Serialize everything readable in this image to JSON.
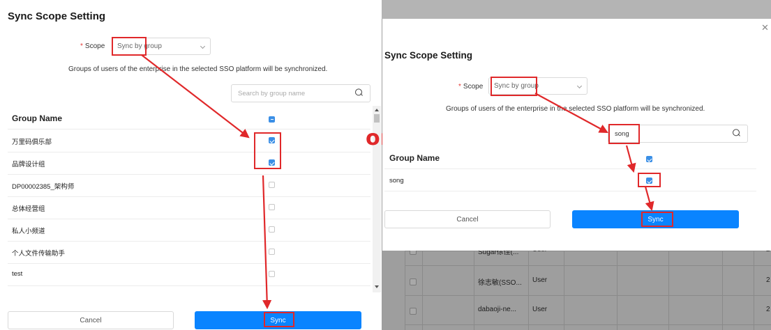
{
  "left_dialog": {
    "title": "Sync Scope Setting",
    "scope": {
      "required_mark": "*",
      "label": "Scope",
      "selected": "Sync by group"
    },
    "description": "Groups of users of the enterprise in the selected SSO platform will be synchronized.",
    "search": {
      "placeholder": "Search by group name",
      "value": ""
    },
    "column_header": "Group Name",
    "header_checkbox": "indeterminate",
    "rows": [
      {
        "name": "万里码俱乐部",
        "checked": true
      },
      {
        "name": "品牌设计组",
        "checked": true
      },
      {
        "name": "DP00002385_架构师",
        "checked": false
      },
      {
        "name": "总体经营组",
        "checked": false
      },
      {
        "name": "私人小频道",
        "checked": false
      },
      {
        "name": "个人文件传输助手",
        "checked": false
      },
      {
        "name": "test",
        "checked": false
      }
    ],
    "cancel_label": "Cancel",
    "sync_label": "Sync"
  },
  "separator_text": "or",
  "right_dialog": {
    "title": "Sync Scope Setting",
    "close_icon": "close-icon",
    "scope": {
      "required_mark": "*",
      "label": "Scope",
      "selected": "Sync by group"
    },
    "description": "Groups of users of the enterprise in the selected SSO platform will be synchronized.",
    "search": {
      "placeholder": "",
      "value": "song"
    },
    "column_header": "Group Name",
    "header_checkbox": "checked",
    "rows": [
      {
        "name": "song",
        "checked": true
      }
    ],
    "cancel_label": "Cancel",
    "sync_label": "Sync"
  },
  "background_table": {
    "rows": [
      {
        "name": "Sugar徐佳(...",
        "role": "User"
      },
      {
        "name": "徐志敏(SSO...",
        "role": "User"
      },
      {
        "name": "dabaoji-ne...",
        "role": "User"
      }
    ],
    "trailing_digit": "2"
  },
  "colors": {
    "annotation": "#e0282a",
    "primary": "#0a84ff",
    "checkbox": "#3b8fe6"
  }
}
